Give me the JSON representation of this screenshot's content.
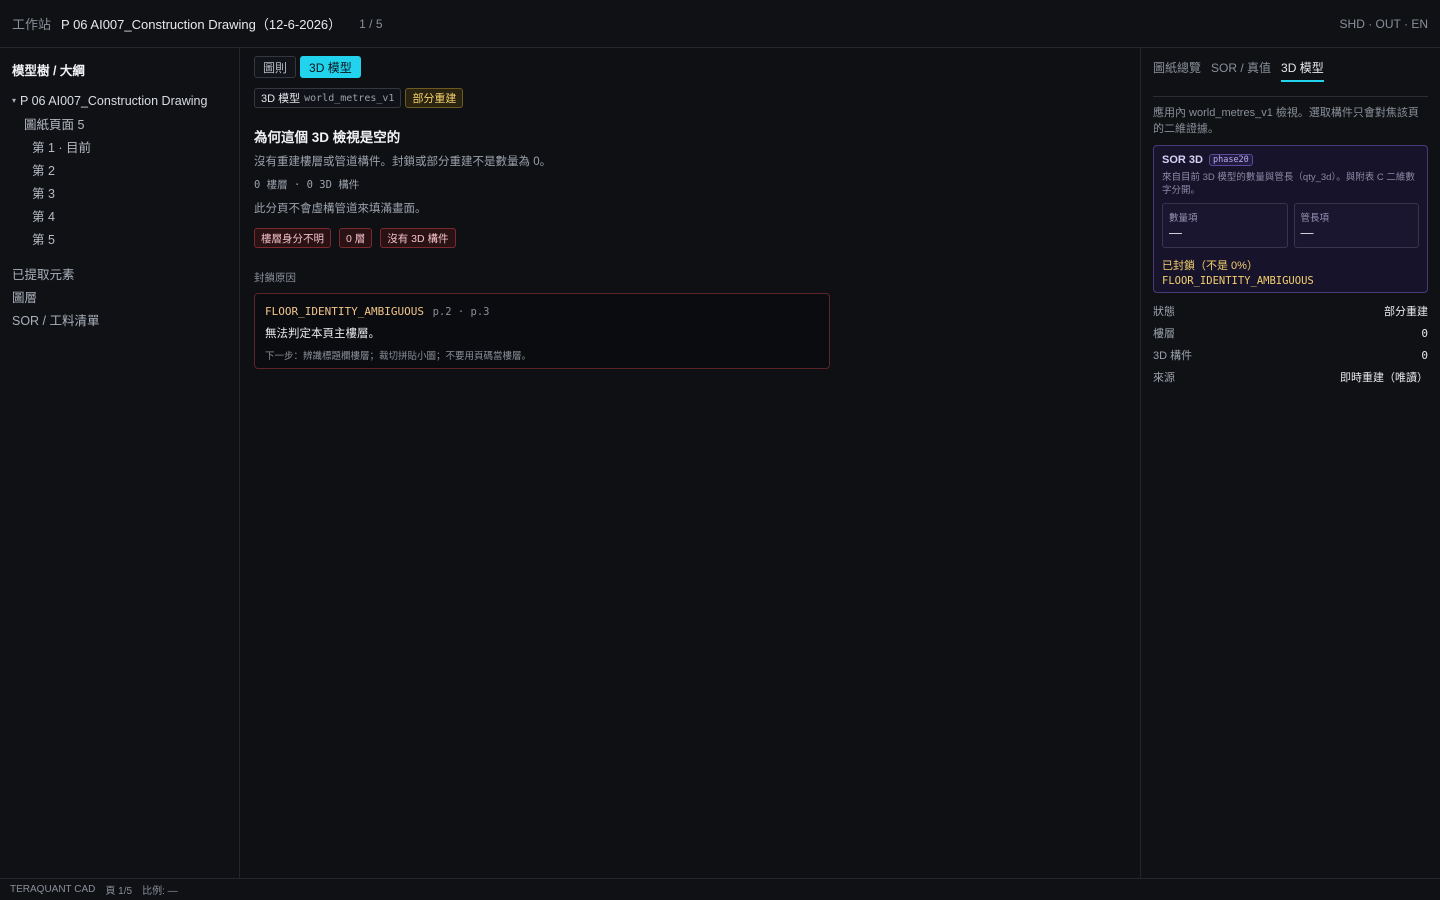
{
  "topbar": {
    "workspace": "工作站",
    "document_title": "P 06 AI007_Construction Drawing（12-6-2026）",
    "page_indicator": "1 / 5",
    "flags": "SHD · OUT · EN"
  },
  "sidebar": {
    "title": "模型樹 / 大綱",
    "root": "P 06 AI007_Construction Drawing",
    "pages_group": "圖紙頁面 5",
    "pages": [
      "第 1 · 目前",
      "第 2",
      "第 3",
      "第 4",
      "第 5"
    ],
    "sections": [
      "已提取元素",
      "圖層",
      "SOR / 工料清單"
    ]
  },
  "main": {
    "tabs": [
      "圖則",
      "3D 模型"
    ],
    "model_badge_label": "3D 模型",
    "model_badge_code": "world_metres_v1",
    "status_badge": "部分重建",
    "heading": "為何這個 3D 檢視是空的",
    "description": "沒有重建樓層或管道構件。封鎖或部分重建不是數量為 0。",
    "stats": "0 樓層 · 0 3D 構件",
    "note": "此分頁不會虛構管道來填滿畫面。",
    "chips": [
      "樓層身分不明",
      "0 層",
      "沒有 3D 構件"
    ],
    "reason_label": "封鎖原因",
    "reason": {
      "code": "FLOOR_IDENTITY_AMBIGUOUS",
      "pages": "p.2 · p.3",
      "message": "無法判定本頁主樓層。",
      "next_step": "下一步：辨識標題欄樓層；裁切拼貼小圖；不要用頁碼當樓層。"
    }
  },
  "right": {
    "tabs": [
      "圖紙總覽",
      "SOR / 真值",
      "3D 模型"
    ],
    "intro": "應用內 world_metres_v1 檢視。選取構件只會對焦該頁的二維證據。",
    "sor": {
      "title": "SOR 3D",
      "tag": "phase20",
      "subtitle": "來自目前 3D 模型的數量與管長（qty_3d）。與附表 C 二維數字分開。",
      "qty_label": "數量項",
      "qty_value": "—",
      "len_label": "管長項",
      "len_value": "—",
      "blocked": "已封鎖（不是 0%）",
      "blocked_code": "FLOOR_IDENTITY_AMBIGUOUS"
    },
    "props": [
      {
        "k": "狀態",
        "v": "部分重建"
      },
      {
        "k": "樓層",
        "v": "0"
      },
      {
        "k": "3D 構件",
        "v": "0"
      },
      {
        "k": "來源",
        "v": "即時重建（唯讀）"
      }
    ]
  },
  "footer": {
    "app": "TERAQUANT CAD",
    "page": "頁 1/5",
    "scale": "比例: —"
  },
  "colors": {
    "accent": "#22d3ee",
    "warning": "#f2cf6e",
    "danger_border": "#7a2a2f",
    "sor_border": "#4b3a7a"
  }
}
